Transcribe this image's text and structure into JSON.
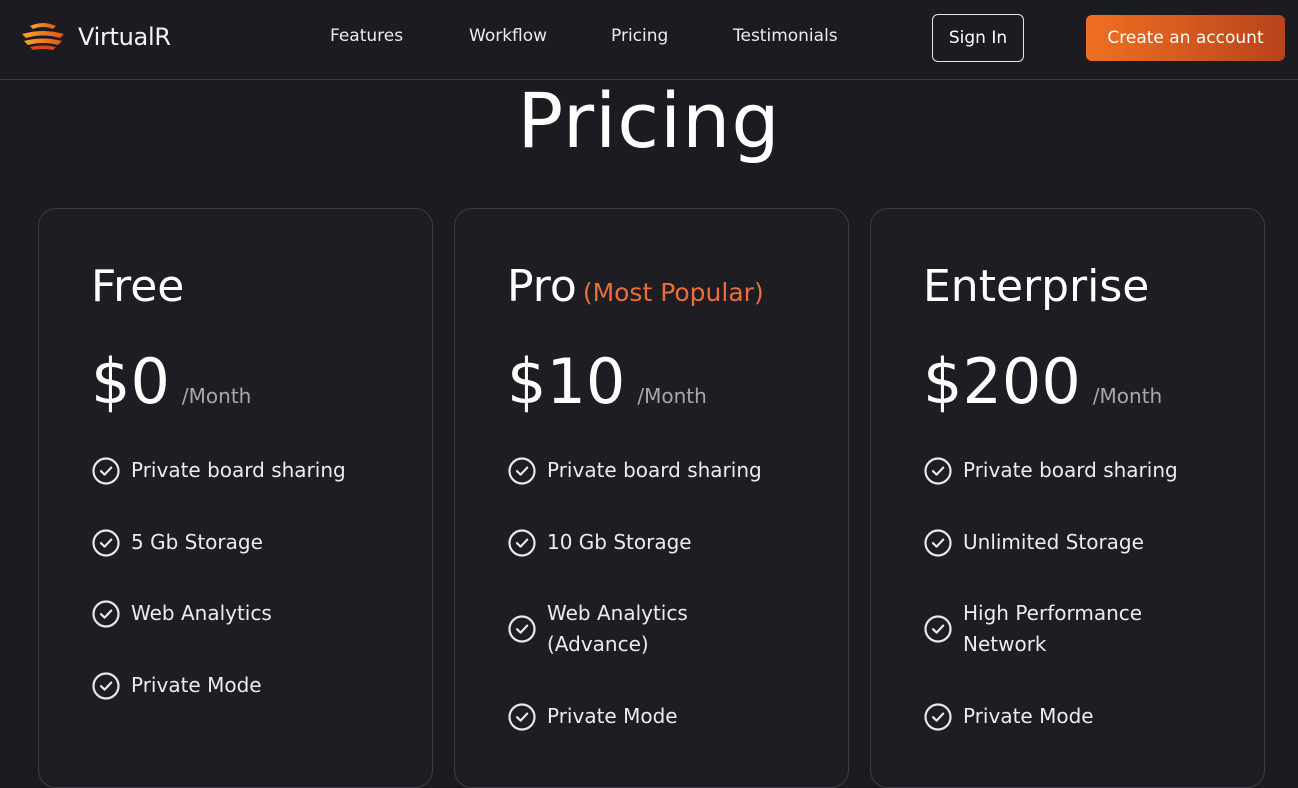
{
  "nav": {
    "brand": "VirtualR",
    "links": [
      "Features",
      "Workflow",
      "Pricing",
      "Testimonials"
    ],
    "signin_label": "Sign In",
    "create_label": "Create an account"
  },
  "page": {
    "title": "Pricing"
  },
  "plans": [
    {
      "name": "Free",
      "badge": "",
      "price": "$0",
      "period": "/Month",
      "features": [
        "Private board sharing",
        "5 Gb Storage",
        "Web Analytics",
        "Private Mode"
      ]
    },
    {
      "name": "Pro",
      "badge": "(Most Popular)",
      "price": "$10",
      "period": "/Month",
      "features": [
        "Private board sharing",
        "10 Gb Storage",
        "Web Analytics (Advance)",
        "Private Mode"
      ]
    },
    {
      "name": "Enterprise",
      "badge": "",
      "price": "$200",
      "period": "/Month",
      "features": [
        "Private board sharing",
        "Unlimited Storage",
        "High Performance Network",
        "Private Mode"
      ]
    }
  ],
  "colors": {
    "accent": "#f07022",
    "badge": "#ec6c3c",
    "background": "#1c1b21"
  },
  "icons": {
    "feature": "check-circle-icon",
    "logo": "virtualr-logo-icon"
  }
}
